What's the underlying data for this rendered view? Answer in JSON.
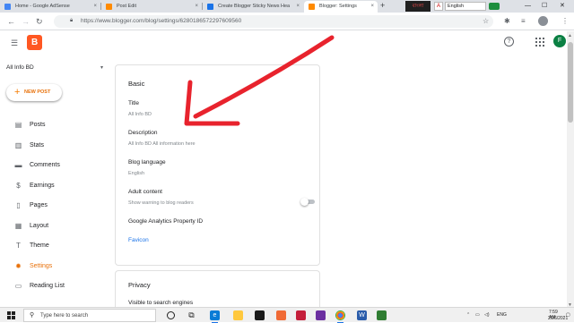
{
  "browser": {
    "tabs": [
      {
        "label": "Home - Google AdSense",
        "favicon": "adsense-icon",
        "color": "#4285f4",
        "active": false
      },
      {
        "label": "Post Edit",
        "favicon": "blogger-icon",
        "color": "#ff8a00",
        "active": false
      },
      {
        "label": "Create Blogger Sticky News Hea",
        "favicon": "docs-icon",
        "color": "#1a73e8",
        "active": false
      },
      {
        "label": "Blogger: Settings",
        "favicon": "blogger-icon",
        "color": "#ff8a00",
        "active": true
      }
    ],
    "close_glyph": "×",
    "new_tab_glyph": "+",
    "extension_lang": "English",
    "extension_badge": "বাংলা",
    "url": "https://www.blogger.com/blog/settings/6280186572297609560",
    "minimize": "—",
    "maximize": "☐",
    "close": "✕"
  },
  "app": {
    "avatar_letter": "F",
    "help_glyph": "?",
    "logo_letter": "B",
    "blog_name": "All Info BD",
    "new_post_label": "NEW POST",
    "nav": [
      {
        "label": "Posts",
        "icon": "posts-icon",
        "glyph": "▤",
        "active": false
      },
      {
        "label": "Stats",
        "icon": "stats-icon",
        "glyph": "▥",
        "active": false
      },
      {
        "label": "Comments",
        "icon": "comments-icon",
        "glyph": "▬",
        "active": false
      },
      {
        "label": "Earnings",
        "icon": "earnings-icon",
        "glyph": "$",
        "active": false
      },
      {
        "label": "Pages",
        "icon": "pages-icon",
        "glyph": "▯",
        "active": false
      },
      {
        "label": "Layout",
        "icon": "layout-icon",
        "glyph": "▦",
        "active": false
      },
      {
        "label": "Theme",
        "icon": "theme-icon",
        "glyph": "T",
        "active": false
      },
      {
        "label": "Settings",
        "icon": "settings-icon",
        "glyph": "✹",
        "active": true
      },
      {
        "label": "Reading List",
        "icon": "reading-list-icon",
        "glyph": "▭",
        "active": false
      }
    ]
  },
  "settings": {
    "basic": {
      "heading": "Basic",
      "title_label": "Title",
      "title_value": "All Info BD",
      "description_label": "Description",
      "description_value": "All Info BD All information here",
      "language_label": "Blog language",
      "language_value": "English",
      "adult_label": "Adult content",
      "adult_hint": "Show warning to blog readers",
      "adult_enabled": false,
      "analytics_label": "Google Analytics Property ID",
      "favicon_link": "Favicon"
    },
    "privacy": {
      "heading": "Privacy",
      "visible_label": "Visible to search engines"
    }
  },
  "taskbar": {
    "search_placeholder": "Type here to search",
    "language": "ENG",
    "time": "7:59 AM",
    "date": "2/26/2021"
  },
  "colors": {
    "accent": "#e8710a",
    "link": "#1a73e8",
    "annotation": "#e8232d"
  }
}
